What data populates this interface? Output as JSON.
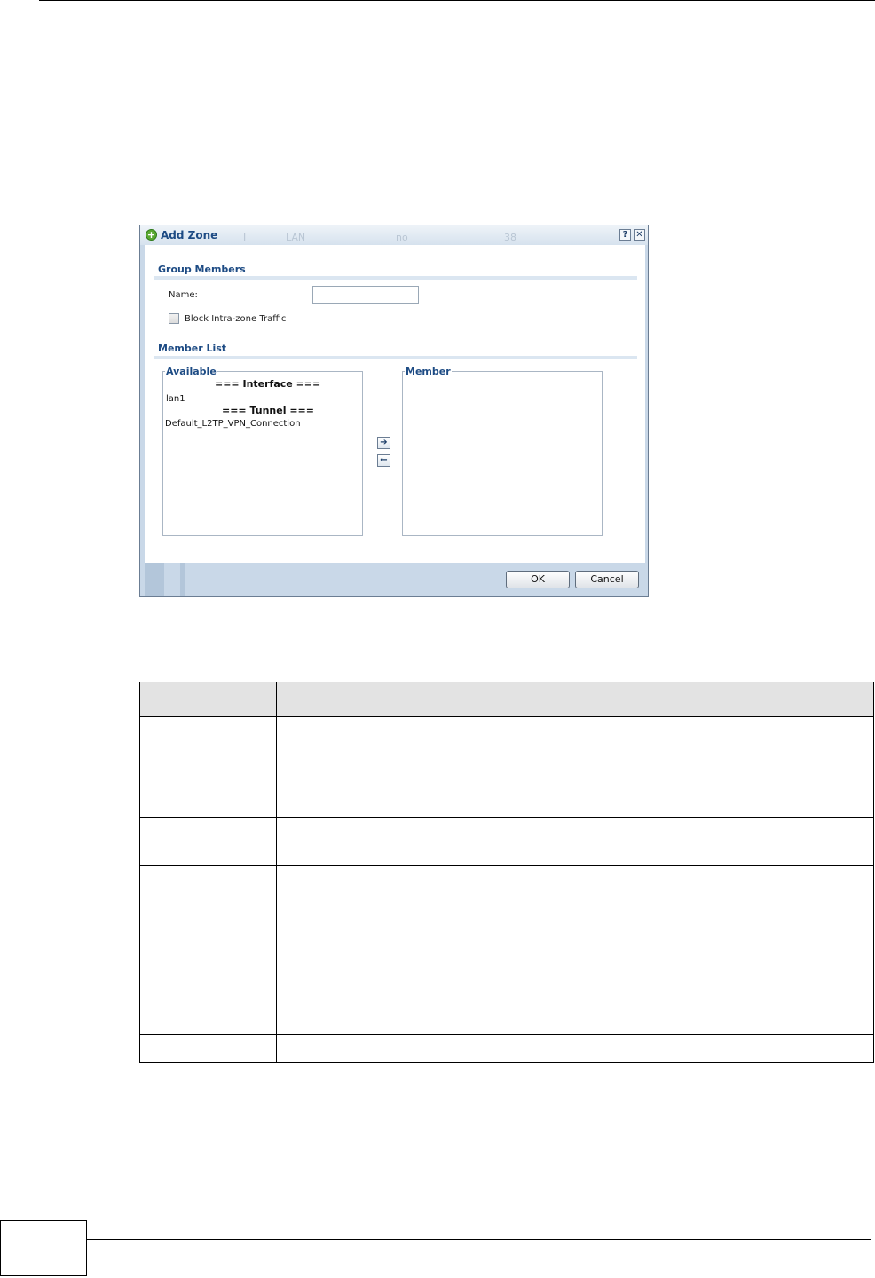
{
  "dialog": {
    "title": "Add Zone",
    "ghost_text": [
      "I",
      "LAN",
      "no",
      "38"
    ],
    "help_label": "?",
    "close_label": "✕",
    "group_members": {
      "section_title": "Group Members",
      "name_label": "Name:",
      "name_value": "",
      "block_label": "Block Intra-zone Traffic",
      "block_checked": false
    },
    "member_list": {
      "section_title": "Member List",
      "available_legend": "Available",
      "member_legend": "Member",
      "available_items": [
        {
          "label": "=== Interface ===",
          "header": true
        },
        {
          "label": "lan1",
          "header": false
        },
        {
          "label": "=== Tunnel ===",
          "header": true
        },
        {
          "label": "Default_L2TP_VPN_Connection",
          "header": false
        }
      ],
      "member_items": [],
      "add_arrow": "➔",
      "remove_arrow": "←"
    },
    "ok_label": "OK",
    "cancel_label": "Cancel"
  },
  "colors": {
    "title": "#1d4b84",
    "dialog_frame": "#c9d8e8",
    "table_header": "#e3e3e3"
  }
}
